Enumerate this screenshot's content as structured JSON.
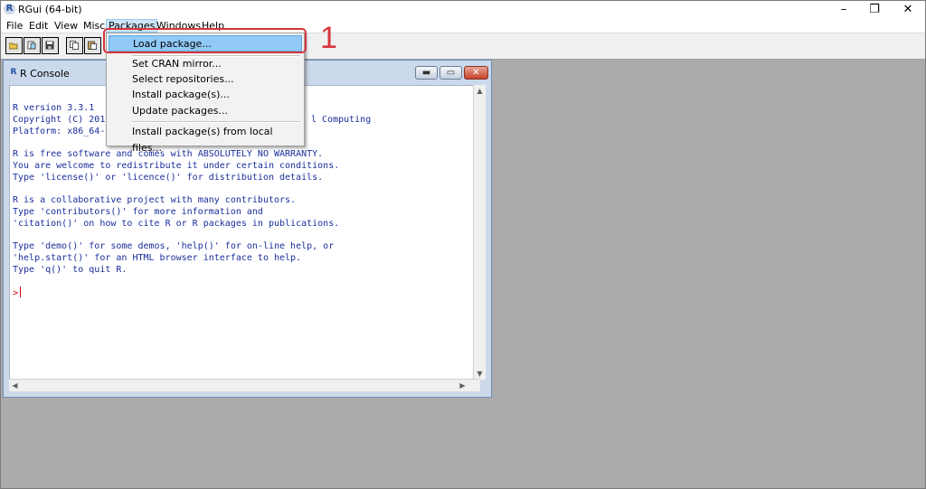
{
  "window": {
    "title": "RGui (64-bit)",
    "app_icon": "R",
    "minimize_glyph": "–",
    "restore_glyph": "❐",
    "close_glyph": "✕"
  },
  "menu": {
    "items": [
      "File",
      "Edit",
      "View",
      "Misc",
      "Packages",
      "Windows",
      "Help"
    ],
    "active": "Packages"
  },
  "dropdown": {
    "items": [
      "Load package...",
      "Set CRAN mirror...",
      "Select repositories...",
      "Install package(s)...",
      "Update packages...",
      "Install package(s) from local files..."
    ],
    "highlighted": "Load package..."
  },
  "annotation": {
    "number": "1",
    "color": "#d9353c"
  },
  "console": {
    "title": "R Console",
    "icon": "R",
    "lines": [
      "R version 3.3.1",
      "Copyright (C) 201",
      "Platform: x86_64-",
      "",
      "R is free software and comes with ABSOLUTELY NO WARRANTY.",
      "You are welcome to redistribute it under certain conditions.",
      "Type 'license()' or 'licence()' for distribution details.",
      "",
      "R is a collaborative project with many contributors.",
      "Type 'contributors()' for more information and",
      "'citation()' on how to cite R or R packages in publications.",
      "",
      "Type 'demo()' for some demos, 'help()' for on-line help, or",
      "'help.start()' for an HTML browser interface to help.",
      "Type 'q()' to quit R."
    ],
    "line1_tail": "l Computing",
    "prompt": ">",
    "text_color": "#1a2e9c",
    "prompt_color": "#d10000"
  }
}
